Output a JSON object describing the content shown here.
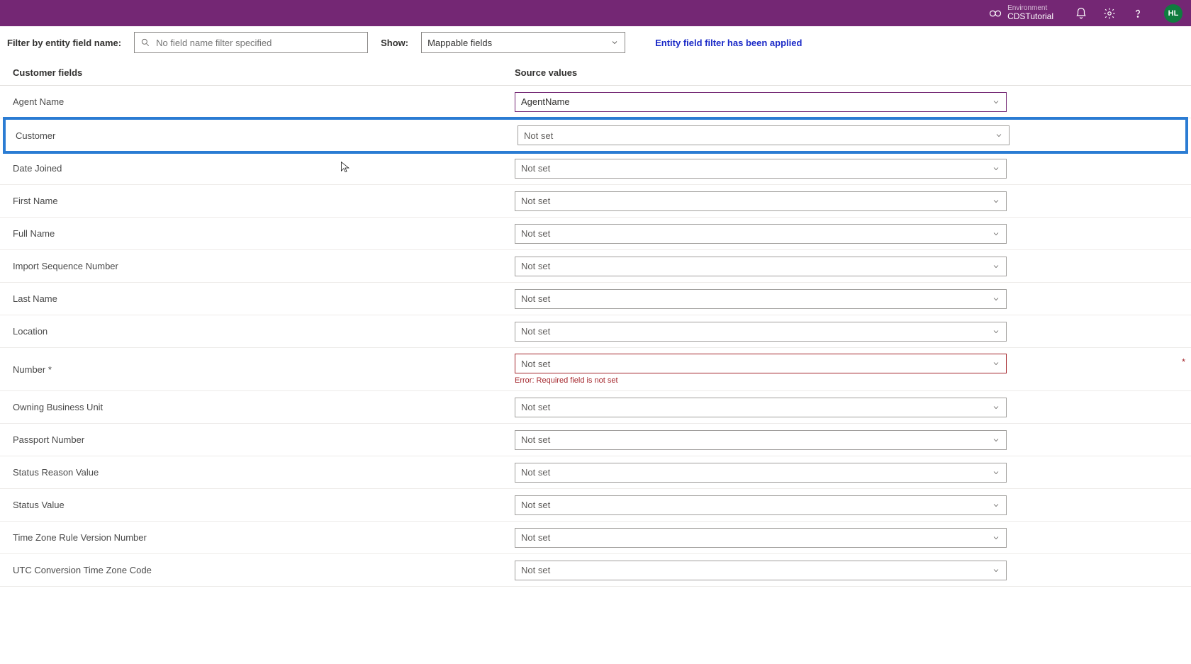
{
  "header": {
    "env_label": "Environment",
    "env_value": "CDSTutorial",
    "avatar_initials": "HL"
  },
  "filter_bar": {
    "filter_label": "Filter by entity field name:",
    "search_placeholder": "No field name filter specified",
    "show_label": "Show:",
    "show_value": "Mappable fields",
    "filter_applied_msg": "Entity field filter has been applied"
  },
  "columns": {
    "left": "Customer fields",
    "right": "Source values"
  },
  "placeholder_not_set": "Not set",
  "error_required": "Error: Required field is not set",
  "rows": [
    {
      "label": "Agent Name",
      "value": "AgentName",
      "hasValue": true,
      "outlined": true
    },
    {
      "label": "Customer",
      "value": "",
      "hasValue": false,
      "highlight": true
    },
    {
      "label": "Date Joined",
      "value": "",
      "hasValue": false
    },
    {
      "label": "First Name",
      "value": "",
      "hasValue": false
    },
    {
      "label": "Full Name",
      "value": "",
      "hasValue": false
    },
    {
      "label": "Import Sequence Number",
      "value": "",
      "hasValue": false
    },
    {
      "label": "Last Name",
      "value": "",
      "hasValue": false
    },
    {
      "label": "Location",
      "value": "",
      "hasValue": false
    },
    {
      "label": "Number *",
      "value": "",
      "hasValue": false,
      "error": true,
      "requiredStar": true
    },
    {
      "label": "Owning Business Unit",
      "value": "",
      "hasValue": false
    },
    {
      "label": "Passport Number",
      "value": "",
      "hasValue": false
    },
    {
      "label": "Status Reason Value",
      "value": "",
      "hasValue": false
    },
    {
      "label": "Status Value",
      "value": "",
      "hasValue": false
    },
    {
      "label": "Time Zone Rule Version Number",
      "value": "",
      "hasValue": false
    },
    {
      "label": "UTC Conversion Time Zone Code",
      "value": "",
      "hasValue": false
    }
  ]
}
